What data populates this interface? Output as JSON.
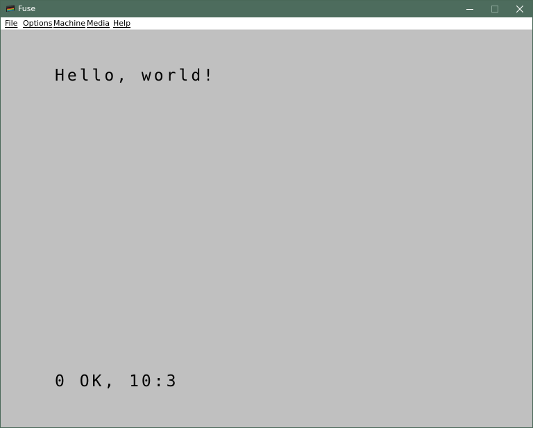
{
  "window": {
    "title": "Fuse",
    "controls": {
      "minimize_icon": "minimize-icon",
      "maximize_icon": "maximize-icon",
      "close_icon": "close-icon"
    },
    "colors": {
      "titlebar": "#4d6c5d",
      "screen_background": "#c0c0c0",
      "text": "#000000"
    }
  },
  "menu": {
    "items": [
      {
        "label": "File",
        "accelerator": "F"
      },
      {
        "label": "Options",
        "accelerator": "O"
      },
      {
        "label": "Machine",
        "accelerator": "M"
      },
      {
        "label": "Media",
        "accelerator": "M"
      },
      {
        "label": "Help",
        "accelerator": "H"
      }
    ]
  },
  "emulator": {
    "output_line": "Hello, world!",
    "status_line": "0 OK, 10:3"
  }
}
